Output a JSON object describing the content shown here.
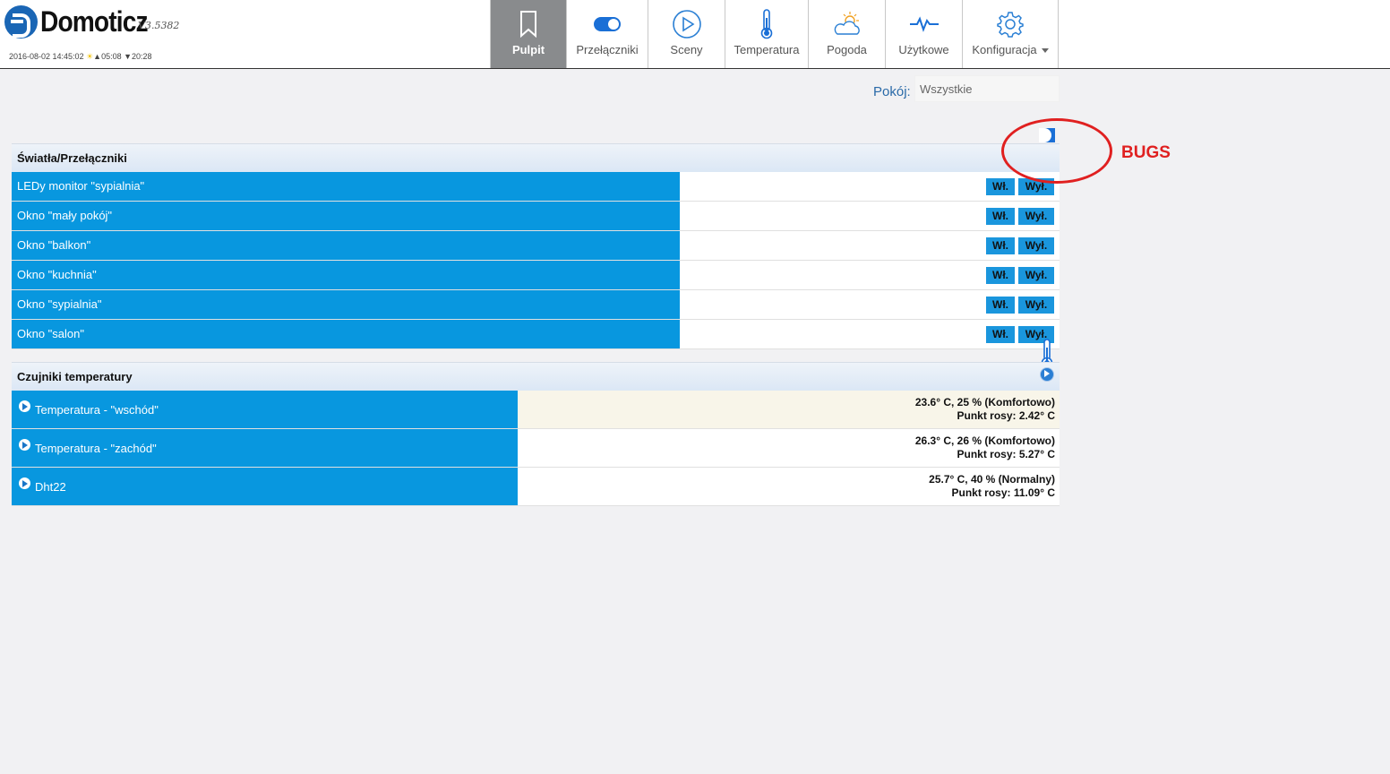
{
  "header": {
    "app_name": "Domoticz",
    "version": "V3.5382",
    "datetime": "2016-08-02 14:45:02",
    "sunrise": "▲05:08",
    "sunset": "▼20:28"
  },
  "nav": {
    "items": [
      {
        "label": "Pulpit",
        "icon": "bookmark-icon",
        "active": true
      },
      {
        "label": "Przełączniki",
        "icon": "toggle-icon"
      },
      {
        "label": "Sceny",
        "icon": "play-circle-icon"
      },
      {
        "label": "Temperatura",
        "icon": "thermometer-icon"
      },
      {
        "label": "Pogoda",
        "icon": "weather-icon"
      },
      {
        "label": "Użytkowe",
        "icon": "pulse-icon"
      },
      {
        "label": "Konfiguracja",
        "icon": "gear-icon"
      }
    ]
  },
  "room": {
    "label": "Pokój:",
    "selected": "Wszystkie"
  },
  "switches": {
    "title": "Światła/Przełączniki",
    "on_label": "Wł.",
    "off_label": "Wył.",
    "rows": [
      {
        "name": "LEDy monitor \"sypialnia\""
      },
      {
        "name": "Okno \"mały pokój\""
      },
      {
        "name": "Okno \"balkon\""
      },
      {
        "name": "Okno \"kuchnia\""
      },
      {
        "name": "Okno \"sypialnia\""
      },
      {
        "name": "Okno \"salon\""
      }
    ]
  },
  "temps": {
    "title": "Czujniki temperatury",
    "rows": [
      {
        "name": "Temperatura - \"wschód\"",
        "value": "23.6° C, 25 % (Komfortowo)",
        "dew": "Punkt rosy: 2.42° C"
      },
      {
        "name": "Temperatura - \"zachód\"",
        "value": "26.3° C, 26 % (Komfortowo)",
        "dew": "Punkt rosy: 5.27° C"
      },
      {
        "name": "Dht22",
        "value": "25.7° C, 40 % (Normalny)",
        "dew": "Punkt rosy: 11.09° C"
      }
    ]
  },
  "annotation": {
    "text": "BUGS",
    "color": "#e02020"
  },
  "colors": {
    "accent": "#0897df",
    "nav_active": "#898b8d"
  }
}
